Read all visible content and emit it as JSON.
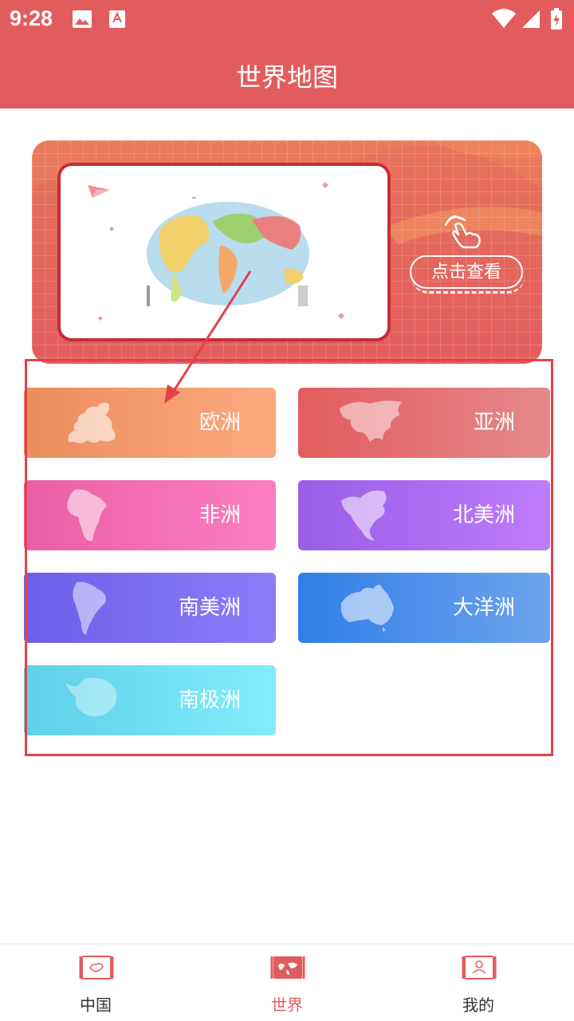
{
  "status_bar": {
    "time": "9:28"
  },
  "header": {
    "title": "世界地图"
  },
  "banner": {
    "button_label": "点击查看"
  },
  "continents": [
    {
      "name": "欧洲"
    },
    {
      "name": "亚洲"
    },
    {
      "name": "非洲"
    },
    {
      "name": "北美洲"
    },
    {
      "name": "南美洲"
    },
    {
      "name": "大洋洲"
    },
    {
      "name": "南极洲"
    }
  ],
  "bottom_nav": {
    "items": [
      {
        "label": "中国",
        "icon": "china-map-scroll-icon"
      },
      {
        "label": "世界",
        "icon": "world-map-scroll-icon",
        "active": true
      },
      {
        "label": "我的",
        "icon": "profile-scroll-icon"
      }
    ]
  },
  "colors": {
    "brand": "#e25c5e",
    "annotation": "#e1424a"
  }
}
